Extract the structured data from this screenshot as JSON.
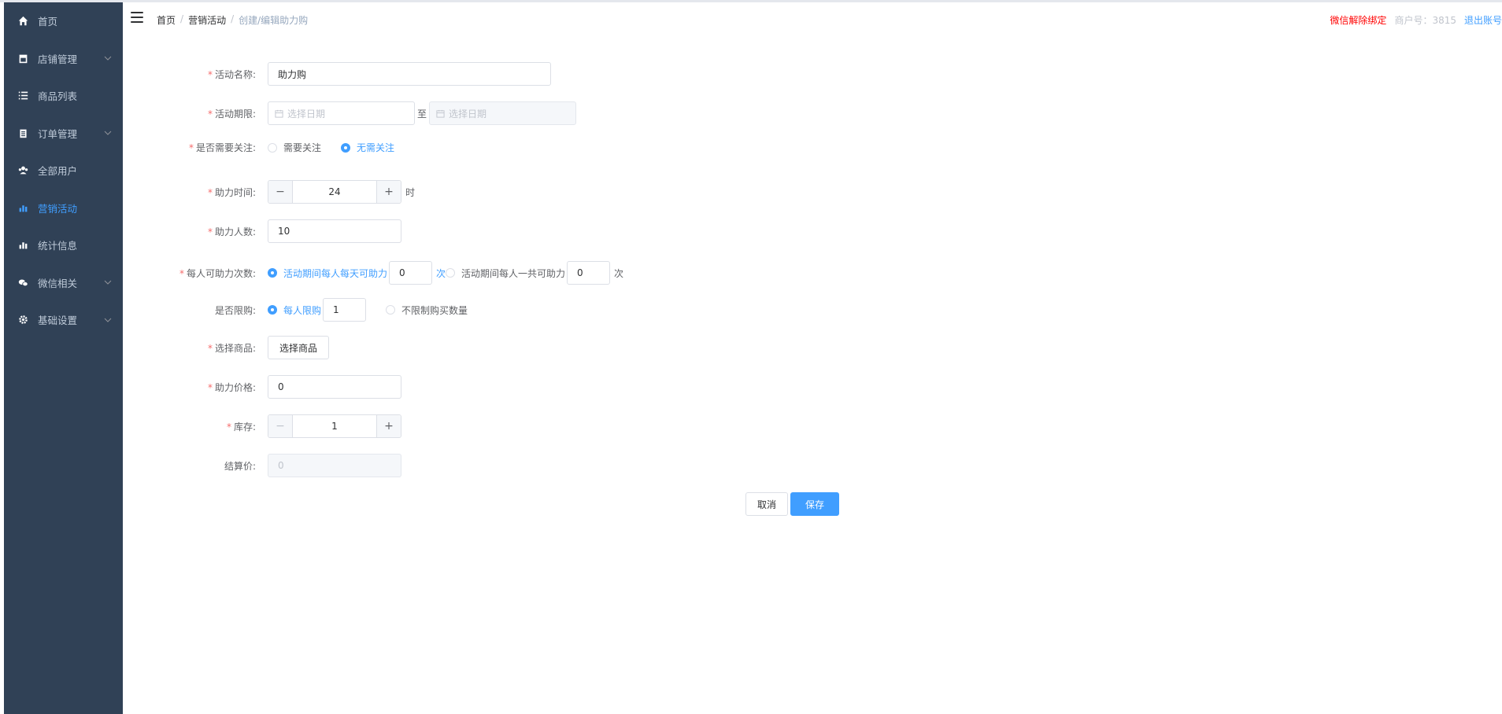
{
  "header": {
    "breadcrumb": [
      "首页",
      "营销活动",
      "创建/编辑助力购"
    ],
    "unbind_wechat": "微信解除绑定",
    "merchant_no": "商户号：3815",
    "logout": "退出账号"
  },
  "sidebar": {
    "items": [
      {
        "label": "首页",
        "icon": "home-icon",
        "expandable": false,
        "active": false
      },
      {
        "label": "店铺管理",
        "icon": "store-icon",
        "expandable": true,
        "active": false
      },
      {
        "label": "商品列表",
        "icon": "list-icon",
        "expandable": false,
        "active": false
      },
      {
        "label": "订单管理",
        "icon": "clipboard-icon",
        "expandable": true,
        "active": false
      },
      {
        "label": "全部用户",
        "icon": "users-icon",
        "expandable": false,
        "active": false
      },
      {
        "label": "营销活动",
        "icon": "chart-icon",
        "expandable": false,
        "active": true
      },
      {
        "label": "统计信息",
        "icon": "stats-icon",
        "expandable": false,
        "active": false
      },
      {
        "label": "微信相关",
        "icon": "wechat-icon",
        "expandable": true,
        "active": false
      },
      {
        "label": "基础设置",
        "icon": "gear-icon",
        "expandable": true,
        "active": false
      }
    ]
  },
  "form": {
    "name": {
      "label": "活动名称:",
      "value": "助力购"
    },
    "period": {
      "label": "活动期限:",
      "start_placeholder": "选择日期",
      "end_placeholder": "选择日期",
      "to": "至"
    },
    "follow": {
      "label": "是否需要关注:",
      "options": [
        "需要关注",
        "无需关注"
      ],
      "selected": "无需关注"
    },
    "help_time": {
      "label": "助力时间:",
      "value": "24",
      "unit": "时"
    },
    "help_count": {
      "label": "助力人数:",
      "value": "10"
    },
    "help_times": {
      "label": "每人可助力次数:",
      "option_daily": "活动期间每人每天可助力",
      "daily_value": "0",
      "option_total": "活动期间每人一共可助力",
      "total_value": "0",
      "unit": "次",
      "selected": "daily"
    },
    "limit": {
      "label": "是否限购:",
      "option_limit": "每人限购",
      "limit_value": "1",
      "option_unlimited": "不限制购买数量",
      "selected": "limit"
    },
    "product": {
      "label": "选择商品:",
      "button": "选择商品"
    },
    "price": {
      "label": "助力价格:",
      "value": "0"
    },
    "stock": {
      "label": "库存:",
      "value": "1"
    },
    "settle": {
      "label": "结算价:",
      "value": "0"
    }
  },
  "actions": {
    "cancel": "取消",
    "save": "保存"
  },
  "colors": {
    "sidebar_bg": "#304156",
    "sidebar_text": "#bfcbd9",
    "primary": "#409eff",
    "required": "#f56c6c",
    "danger": "#ff0000"
  }
}
